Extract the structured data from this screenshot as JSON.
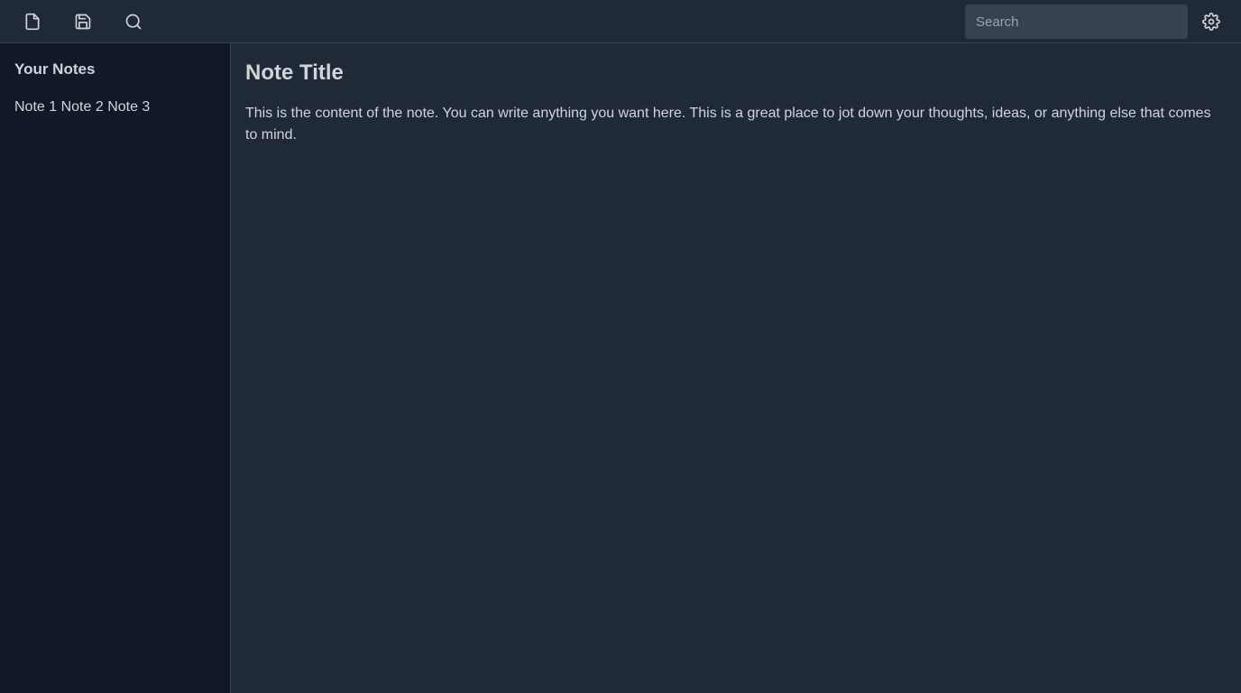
{
  "toolbar": {
    "icons": [
      "file-icon",
      "save-icon",
      "search-icon"
    ],
    "search_placeholder": "Search",
    "settings_icon": "gear-icon"
  },
  "sidebar": {
    "title": "Your Notes",
    "notes": [
      "Note 1",
      "Note 2",
      "Note 3"
    ]
  },
  "main": {
    "title": "Note Title",
    "content": "This is the content of the note. You can write anything you want here. This is a great place to jot down your thoughts, ideas, or anything else that comes to mind."
  },
  "colors": {
    "background": "#1f2937",
    "sidebar": "#111827",
    "input": "#374151",
    "text": "#d1d5db"
  }
}
